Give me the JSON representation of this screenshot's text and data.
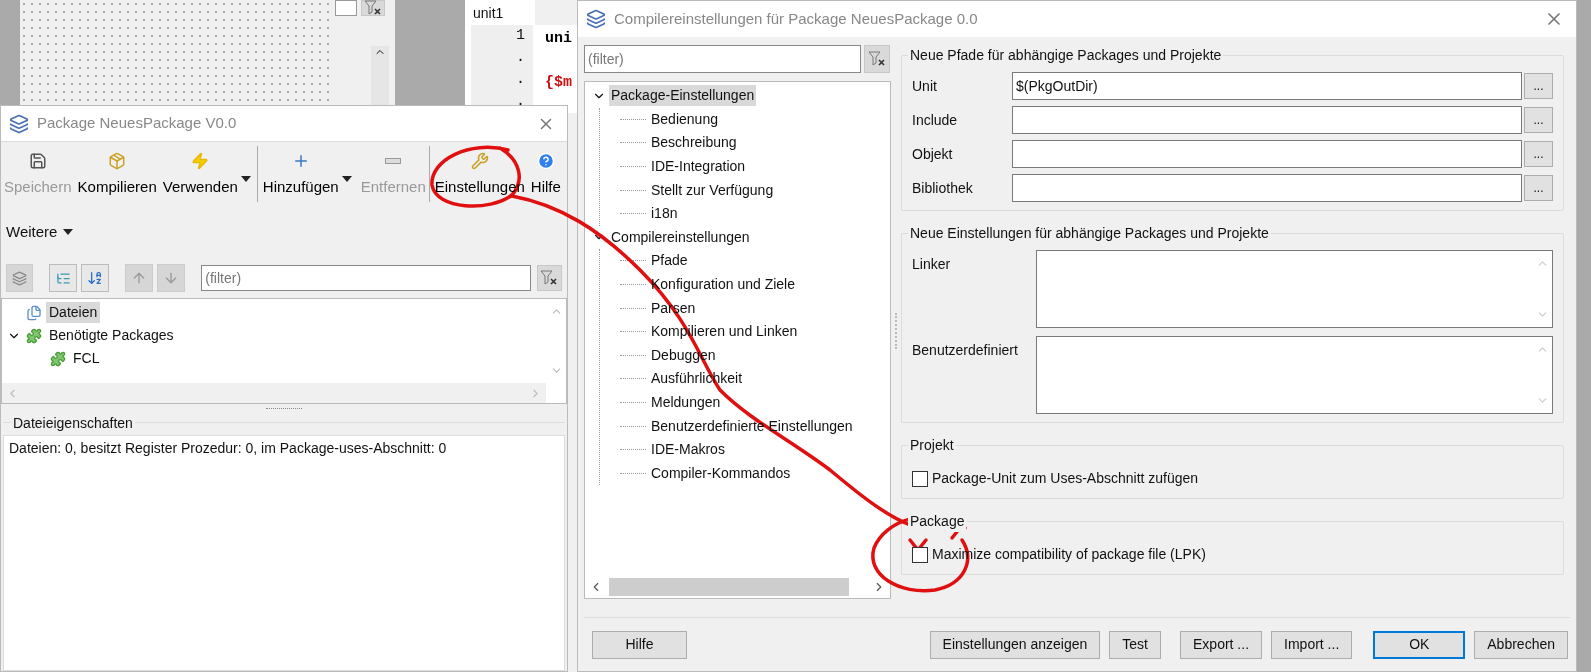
{
  "editor": {
    "tab": "unit1",
    "rows": [
      {
        "number": "1",
        "code": "uni",
        "kind": "keyword"
      },
      {
        "number": "."
      },
      {
        "number": ".",
        "code": "{$m",
        "kind": "directive"
      },
      {
        "number": "."
      }
    ]
  },
  "package_window": {
    "title": "Package NeuesPackage V0.0",
    "toolbar": [
      [
        {
          "label": "Speichern",
          "disabled": true,
          "dropdown": false
        },
        {
          "label": "Kompilieren",
          "disabled": false,
          "dropdown": false
        },
        {
          "label": "Verwenden",
          "disabled": false,
          "dropdown": true
        }
      ],
      [
        {
          "label": "Hinzufügen",
          "disabled": false,
          "dropdown": true
        },
        {
          "label": "Entfernen",
          "disabled": true,
          "dropdown": false
        }
      ],
      [
        {
          "label": "Einstellungen",
          "disabled": false,
          "dropdown": false
        },
        {
          "label": "Hilfe",
          "disabled": false,
          "dropdown": false
        }
      ]
    ],
    "more_menu": "Weitere",
    "filter_placeholder": "(filter)",
    "tree": [
      {
        "label": "Dateien",
        "selected": true,
        "kind": "files"
      },
      {
        "label": "Benötigte Packages",
        "selected": false,
        "kind": "package",
        "expanded": true,
        "children": [
          {
            "label": "FCL",
            "selected": false,
            "kind": "package"
          }
        ]
      }
    ],
    "properties": {
      "title": "Dateieigenschaften",
      "text": "Dateien: 0, besitzt Register Prozedur: 0, im Package-uses-Abschnitt: 0"
    }
  },
  "dialog": {
    "title": "Compilereinstellungen für Package NeuesPackage 0.0",
    "filter_placeholder": "(filter)",
    "tree": [
      {
        "label": "Package-Einstellungen",
        "selected": true,
        "expanded": true,
        "children": [
          {
            "label": "Bedienung",
            "selected": false
          },
          {
            "label": "Beschreibung",
            "selected": false
          },
          {
            "label": "IDE-Integration",
            "selected": false
          },
          {
            "label": "Stellt zur Verfügung",
            "selected": false
          },
          {
            "label": "i18n",
            "selected": false
          }
        ]
      },
      {
        "label": "Compilereinstellungen",
        "selected": false,
        "expanded": true,
        "children": [
          {
            "label": "Pfade",
            "selected": false
          },
          {
            "label": "Konfiguration und Ziele",
            "selected": false
          },
          {
            "label": "Parsen",
            "selected": false
          },
          {
            "label": "Kompilieren und Linken",
            "selected": false
          },
          {
            "label": "Debuggen",
            "selected": false
          },
          {
            "label": "Ausführlichkeit",
            "selected": false
          },
          {
            "label": "Meldungen",
            "selected": false
          },
          {
            "label": "Benutzerdefinierte Einstellungen",
            "selected": false
          },
          {
            "label": "IDE-Makros",
            "selected": false
          },
          {
            "label": "Compiler-Kommandos",
            "selected": false
          }
        ]
      }
    ],
    "paths": {
      "title": "Neue Pfade für abhängige Packages und Projekte",
      "fields": [
        {
          "label": "Unit",
          "value": "$(PkgOutDir)",
          "button": "..."
        },
        {
          "label": "Include",
          "button": "..."
        },
        {
          "label": "Objekt",
          "button": "..."
        },
        {
          "label": "Bibliothek",
          "button": "..."
        }
      ]
    },
    "settings": {
      "title": "Neue Einstellungen für abhängige Packages und Projekte",
      "memos": [
        {
          "label": "Linker"
        },
        {
          "label": "Benutzerdefiniert"
        }
      ]
    },
    "options": [
      {
        "title": "Projekt",
        "label": "Package-Unit zum Uses-Abschnitt zufügen",
        "checked": false
      },
      {
        "title": "Package",
        "label": "Maximize compatibility of package file (LPK)",
        "checked": false
      }
    ],
    "help_button": "Hilfe",
    "buttons": [
      {
        "label": "Einstellungen anzeigen",
        "default": false
      },
      {
        "label": "Test",
        "default": false
      },
      {
        "label": "Export ...",
        "default": false
      },
      {
        "label": "Import ...",
        "default": false
      },
      {
        "label": "OK",
        "default": true
      },
      {
        "label": "Abbrechen",
        "default": false
      }
    ]
  }
}
